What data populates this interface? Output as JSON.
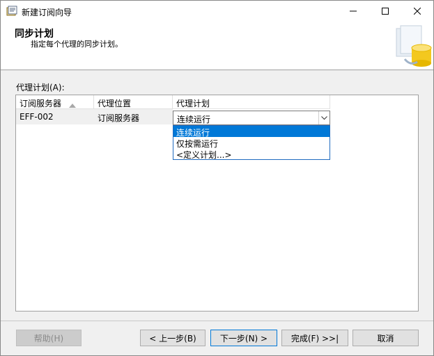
{
  "window": {
    "title": "新建订阅向导",
    "controls": [
      "minimize",
      "maximize",
      "close"
    ]
  },
  "header": {
    "title": "同步计划",
    "subtitle": "指定每个代理的同步计划。"
  },
  "grid": {
    "label": "代理计划(A):",
    "columns": [
      "订阅服务器",
      "代理位置",
      "代理计划"
    ],
    "rows": [
      {
        "subscriber": "EFF-002",
        "location": "订阅服务器",
        "schedule": "连续运行"
      }
    ],
    "dropdown": {
      "selected": "连续运行",
      "options": [
        "连续运行",
        "仅按需运行",
        "<定义计划...>"
      ],
      "highlighted_index": 0
    }
  },
  "buttons": {
    "help": "帮助(H)",
    "back": "< 上一步(B)",
    "next": "下一步(N) >",
    "finish": "完成(F) >>|",
    "cancel": "取消"
  },
  "colors": {
    "highlight": "#0078d7",
    "window_bg": "#f0f0f0",
    "header_bg": "#ffffff"
  }
}
